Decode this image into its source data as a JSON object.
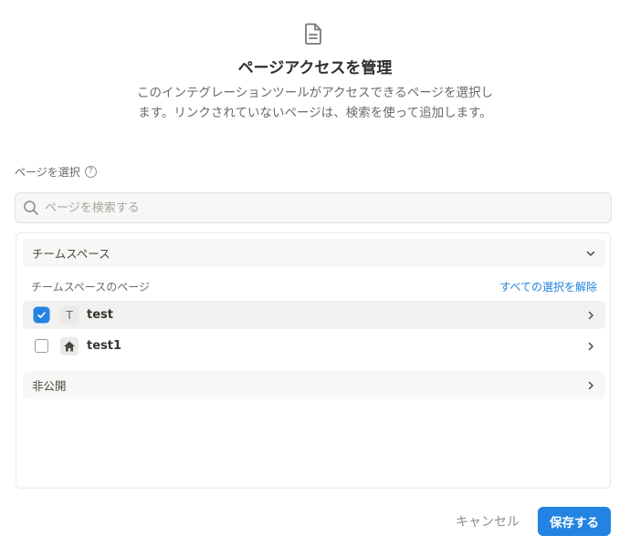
{
  "header": {
    "icon": "document-icon",
    "title": "ページアクセスを管理",
    "description": "このインテグレーションツールがアクセスできるページを選択します。リンクされていないページは、検索を使って追加します。"
  },
  "selection": {
    "label": "ページを選択",
    "help_icon": "question-circle-icon",
    "help_glyph": "?"
  },
  "search": {
    "placeholder": "ページを検索する",
    "value": ""
  },
  "teamspace": {
    "label": "チームスペース",
    "expanded": true,
    "pages_title": "チームスペースのページ",
    "deselect_all": "すべての選択を解除",
    "pages": [
      {
        "name": "test",
        "icon_letter": "T",
        "checked": true
      },
      {
        "name": "test1",
        "icon": "home-icon",
        "checked": false
      }
    ]
  },
  "private": {
    "label": "非公開",
    "expanded": false
  },
  "footer": {
    "cancel_label": "キャンセル",
    "save_label": "保存する"
  },
  "colors": {
    "accent": "#2383e2",
    "text": "#37352f",
    "muted": "#6b6a66"
  }
}
